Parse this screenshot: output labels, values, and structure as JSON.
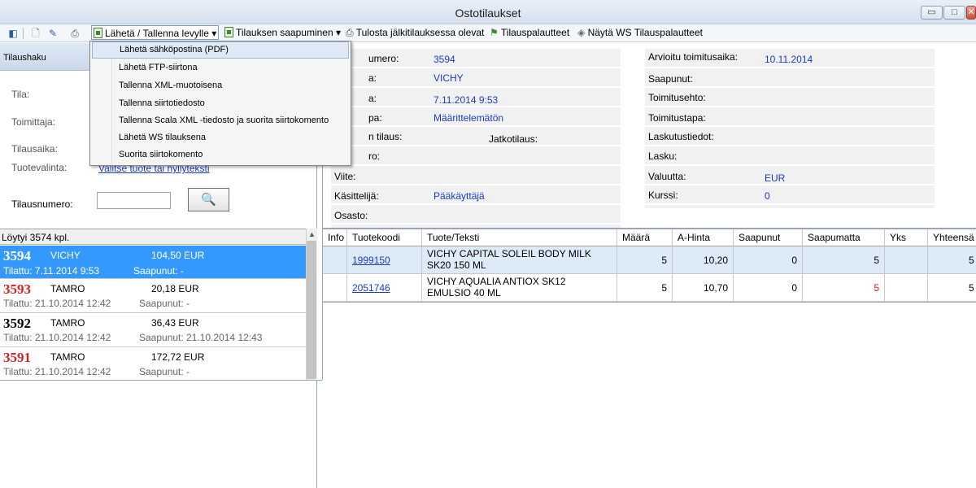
{
  "window": {
    "title": "Ostotilaukset",
    "minimize": "▭",
    "maximize": "□",
    "close": "✕"
  },
  "toolbar": {
    "send_label": "Lähetä / Tallenna levylle",
    "arrival_label": "Tilauksen saapuminen",
    "print_label": "Tulosta jälkitilauksessa olevat",
    "feedback_label": "Tilauspalautteet",
    "ws_label": "Näytä WS Tilauspalautteet",
    "dropdown_arrow": "▾"
  },
  "left_panel": {
    "header": "Tilaushaku",
    "labels": {
      "status": "Tila:",
      "supplier": "Toimittaja:",
      "order_time": "Tilausaika:",
      "product": "Tuotevalinta:",
      "order_number": "Tilausnumero:"
    },
    "select_link": "Valitse tuote tai hyllyteksti",
    "search_value": "",
    "search_icon": "🔍",
    "found": "Löytyi 3574 kpl.",
    "orders": [
      {
        "num": "3594",
        "supplier": "VICHY",
        "amount": "104,50 EUR",
        "ordered": "Tilattu: 7.11.2014 9:53",
        "received": "Saapunut: -"
      },
      {
        "num": "3593",
        "supplier": "TAMRO",
        "amount": "20,18 EUR",
        "ordered": "Tilattu: 21.10.2014 12:42",
        "received": "Saapunut: -"
      },
      {
        "num": "3592",
        "supplier": "TAMRO",
        "amount": "36,43 EUR",
        "ordered": "Tilattu: 21.10.2014 12:42",
        "received": "Saapunut: 21.10.2014 12:43"
      },
      {
        "num": "3591",
        "supplier": "TAMRO",
        "amount": "172,72 EUR",
        "ordered": "Tilattu: 21.10.2014 12:42",
        "received": "Saapunut: -"
      }
    ],
    "colors": {
      "red_num": "#d42020",
      "black_num": "#000000",
      "selected_bg": "#3399ff"
    }
  },
  "details": {
    "number_label": "umero:",
    "number_value": "3594",
    "supplier_label": "a:",
    "supplier_value": "VICHY",
    "time_label": "a:",
    "time_value": "7.11.2014 9:53",
    "type_label": "pa:",
    "type_value": "Määrittelemätön",
    "order_label": "n tilaus:",
    "followup_label": "Jatkotilaus:",
    "ro_label": "ro:",
    "ref_label": "Viite:",
    "handler_label": "Käsittelijä:",
    "handler_value": "Pääkäyttäjä",
    "dept_label": "Osasto:",
    "est_delivery_label": "Arvioitu toimitusaika:",
    "est_delivery_value": "10.11.2014",
    "arrived_label": "Saapunut:",
    "terms_label": "Toimitusehto:",
    "method_label": "Toimitustapa:",
    "billing_label": "Laskutustiedot:",
    "invoice_label": "Lasku:",
    "currency_label": "Valuutta:",
    "currency_value": "EUR",
    "rate_label": "Kurssi:",
    "rate_value": "0"
  },
  "grid": {
    "headers": [
      "Info",
      "Tuotekoodi",
      "Tuote/Teksti",
      "Määrä",
      "A-Hinta",
      "Saapunut",
      "Saapumatta",
      "Yks",
      "Yhteensä"
    ],
    "rows": [
      {
        "info": "",
        "code": "1999150",
        "text": "VICHY CAPITAL SOLEIL BODY MILK SK20  150 ML",
        "qty": "5",
        "price": "10,20",
        "arrived": "0",
        "pending": "5",
        "unit": "",
        "total": "5"
      },
      {
        "info": "",
        "code": "2051746",
        "text": "VICHY AQUALIA ANTIOX SK12 EMULSIO  40 ML",
        "qty": "5",
        "price": "10,70",
        "arrived": "0",
        "pending": "5",
        "unit": "",
        "total": "5"
      }
    ]
  },
  "menu": {
    "items": [
      "Lähetä sähköpostina (PDF)",
      "Lähetä FTP-siirtona",
      "Tallenna XML-muotoisena",
      "Tallenna siirtotiedosto",
      "Tallenna Scala XML -tiedosto ja suorita siirtokomento",
      "Lähetä WS tilauksena",
      "Suorita siirtokomento"
    ]
  }
}
